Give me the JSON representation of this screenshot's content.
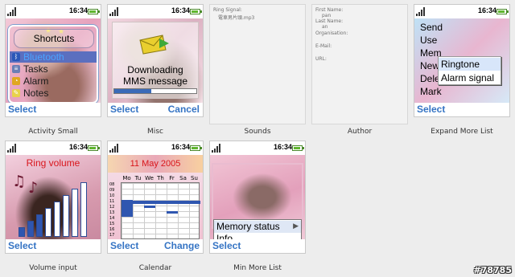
{
  "status": {
    "time": "16:34"
  },
  "tiles": {
    "activity_small": {
      "caption": "Activity Small",
      "title": "Shortcuts",
      "items": [
        "Bluetooth",
        "Tasks",
        "Alarm",
        "Notes"
      ],
      "softkey_left": "Select",
      "icons": [
        "bluetooth-icon",
        "tasks-icon",
        "alarm-bell-icon",
        "notes-icon"
      ]
    },
    "misc": {
      "caption": "Misc",
      "line1": "Downloading",
      "line2": "MMS message",
      "progress": 0.45,
      "softkey_left": "Select",
      "softkey_right": "Cancel"
    },
    "sounds": {
      "caption": "Sounds",
      "label": "Ring Signal:",
      "value": "電車男片頭.mp3"
    },
    "author": {
      "caption": "Author",
      "fields": [
        {
          "label": "First Name:",
          "value": "pan"
        },
        {
          "label": "Last Name:",
          "value": "an"
        },
        {
          "label": "Organisation:",
          "value": ""
        },
        {
          "label": "E-Mail:",
          "value": ""
        },
        {
          "label": "URL:",
          "value": ""
        }
      ]
    },
    "expand_more": {
      "caption": "Expand More List",
      "items": [
        "Send",
        "Use",
        "Mem",
        "New",
        "Delete",
        "Mark"
      ],
      "submenu": [
        "Ringtone",
        "Alarm signal"
      ],
      "softkey_left": "Select"
    },
    "volume": {
      "caption": "Volume input",
      "title": "Ring volume",
      "level": 8,
      "max": 8,
      "softkey_left": "Select"
    },
    "calendar": {
      "caption": "Calendar",
      "title": "11 May 2005",
      "days": [
        "Mo",
        "Tu",
        "We",
        "Th",
        "Fr",
        "Sa",
        "Su"
      ],
      "hours": [
        "08",
        "09",
        "10",
        "11",
        "12",
        "13",
        "14",
        "15",
        "16",
        "17"
      ],
      "softkey_left": "Select",
      "softkey_right": "Change"
    },
    "min_more": {
      "caption": "Min More List",
      "items": [
        "Memory status",
        "Info"
      ],
      "softkey_left": "Select"
    }
  },
  "watermark": "#78785",
  "colors": {
    "softkey": "#3574c4",
    "title_red": "#d9151b",
    "battery": "#5fb52e",
    "menu_highlight": "#5b6fbf"
  }
}
